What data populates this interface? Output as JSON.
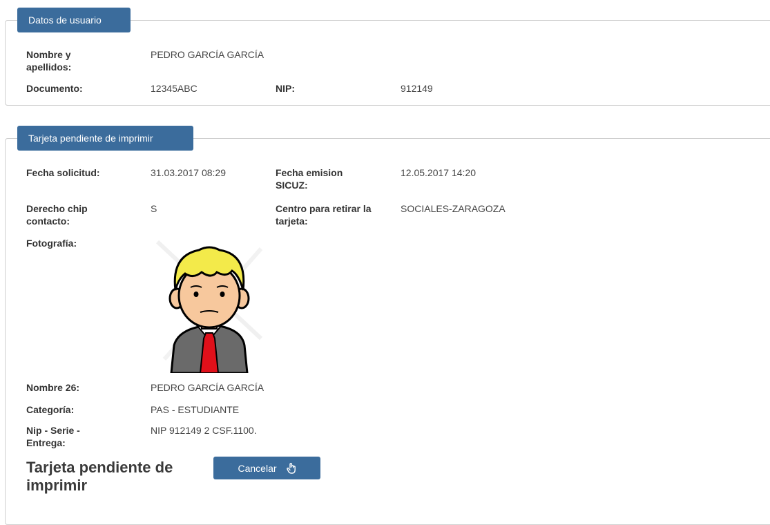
{
  "user_section": {
    "legend": "Datos de usuario",
    "name_label": "Nombre y apellidos:",
    "name_value": "PEDRO GARCÍA GARCÍA",
    "document_label": "Documento:",
    "document_value": "12345ABC",
    "nip_label": "NIP:",
    "nip_value": "912149"
  },
  "card_section": {
    "legend": "Tarjeta pendiente de imprimir",
    "request_date_label": "Fecha solicitud:",
    "request_date_value": "31.03.2017 08:29",
    "emission_date_label": "Fecha emision SICUZ:",
    "emission_date_value": "12.05.2017 14:20",
    "chip_label": "Derecho chip contacto:",
    "chip_value": "S",
    "center_label": "Centro para retirar la tarjeta:",
    "center_value": "SOCIALES-ZARAGOZA",
    "photo_label": "Fotografía:",
    "name26_label": "Nombre 26:",
    "name26_value": "PEDRO GARCÍA GARCÍA",
    "category_label": "Categoría:",
    "category_value": "PAS - ESTUDIANTE",
    "nip_series_label": "Nip - Serie - Entrega:",
    "nip_series_value": "NIP 912149 2 CSF.1100.",
    "status_title": "Tarjeta pendiente de imprimir",
    "cancel_label": "Cancelar"
  },
  "icons": {
    "cancel": "hand-pointer-icon",
    "photo": "user-avatar-illustration"
  },
  "colors": {
    "accent": "#3b6c9c",
    "border": "#cfcfcf"
  }
}
